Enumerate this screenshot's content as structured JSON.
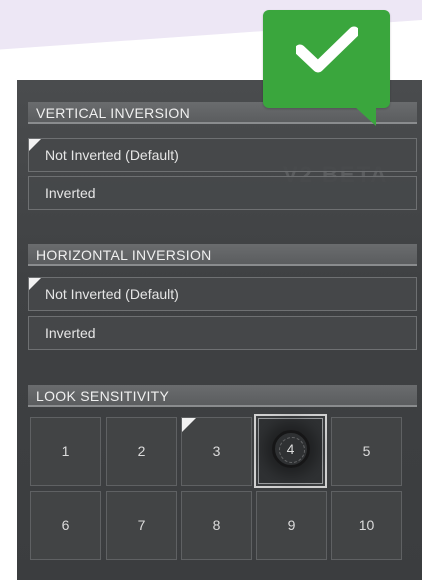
{
  "watermark": "V2 BETA",
  "vertical_inversion": {
    "header": "VERTICAL INVERSION",
    "options": [
      {
        "label": "Not Inverted (Default)",
        "selected": true
      },
      {
        "label": "Inverted",
        "selected": false
      }
    ]
  },
  "horizontal_inversion": {
    "header": "HORIZONTAL INVERSION",
    "options": [
      {
        "label": "Not Inverted (Default)",
        "selected": true
      },
      {
        "label": "Inverted",
        "selected": false
      }
    ]
  },
  "look_sensitivity": {
    "header": "LOOK SENSITIVITY",
    "values": [
      "1",
      "2",
      "3",
      "4",
      "5",
      "6",
      "7",
      "8",
      "9",
      "10"
    ],
    "selected": "3",
    "focused": "4"
  },
  "colors": {
    "check_bubble": "#3aa63d",
    "accent_swoosh": "#ede7f5"
  },
  "icons": {
    "bubble": "checkmark-icon"
  }
}
